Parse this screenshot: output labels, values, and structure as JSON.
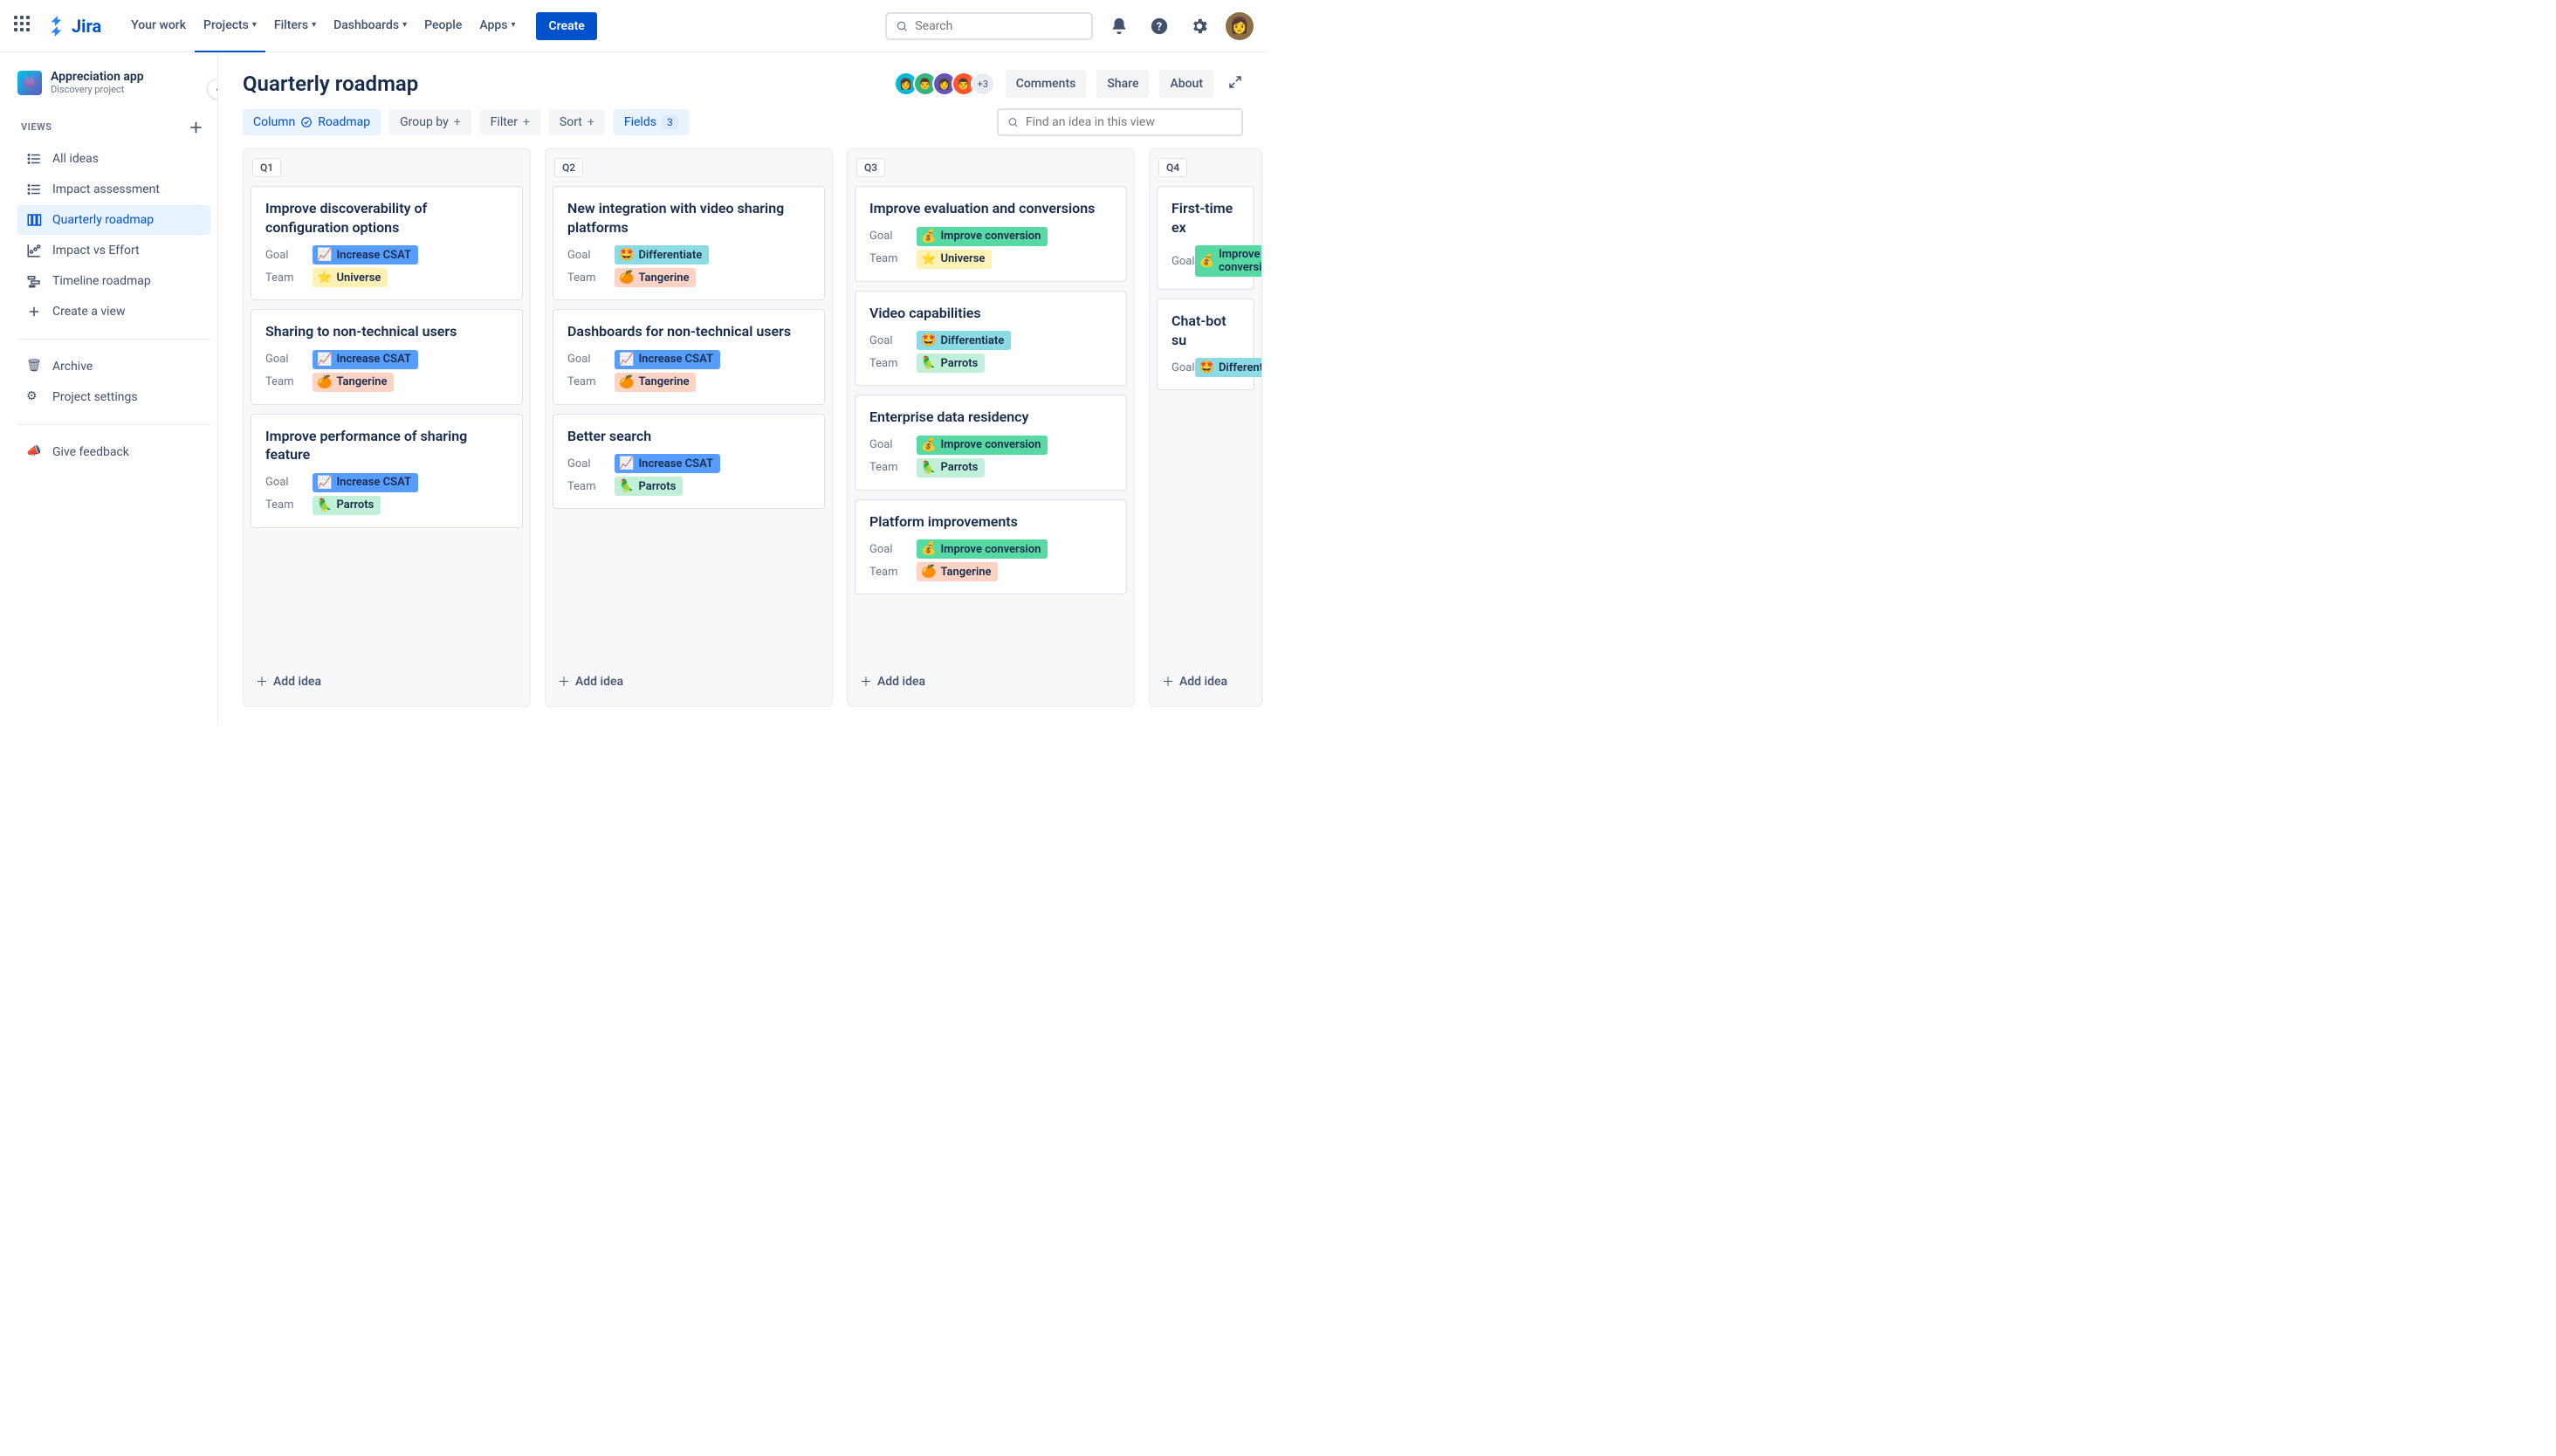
{
  "nav": {
    "logo": "Jira",
    "items": [
      "Your work",
      "Projects",
      "Filters",
      "Dashboards",
      "People",
      "Apps"
    ],
    "create": "Create",
    "search_placeholder": "Search"
  },
  "project": {
    "name": "Appreciation app",
    "type": "Discovery project"
  },
  "sidebar": {
    "views_header": "VIEWS",
    "items": [
      {
        "label": "All ideas",
        "icon": "list"
      },
      {
        "label": "Impact assessment",
        "icon": "list"
      },
      {
        "label": "Quarterly roadmap",
        "icon": "board",
        "active": true
      },
      {
        "label": "Impact vs Effort",
        "icon": "chart"
      },
      {
        "label": "Timeline roadmap",
        "icon": "timeline"
      },
      {
        "label": "Create a view",
        "icon": "plus"
      }
    ],
    "archive": "Archive",
    "settings": "Project settings",
    "feedback": "Give feedback"
  },
  "page": {
    "title": "Quarterly roadmap",
    "avatar_more": "+3",
    "actions": {
      "comments": "Comments",
      "share": "Share",
      "about": "About"
    },
    "controls": {
      "column": "Column",
      "column_value": "Roadmap",
      "group": "Group by",
      "filter": "Filter",
      "sort": "Sort",
      "fields": "Fields",
      "fields_count": "3"
    },
    "find_placeholder": "Find an idea in this view",
    "add_idea": "Add idea"
  },
  "labels": {
    "goal": "Goal",
    "team": "Team"
  },
  "goals": {
    "csat": {
      "text": "Increase CSAT",
      "emoji": "📈",
      "bg": "#579DFF",
      "fg": "#0747A6",
      "bg2": "#4C9AFF"
    },
    "diff": {
      "text": "Differentiate",
      "emoji": "🤩",
      "bg": "#79E2F2"
    },
    "conv": {
      "text": "Improve conversion",
      "emoji": "💰",
      "bg": "#57D9A3"
    }
  },
  "teams": {
    "universe": {
      "text": "Universe",
      "emoji": "⭐",
      "bg": "#FFF0B3"
    },
    "tangerine": {
      "text": "Tangerine",
      "emoji": "🍊",
      "bg": "#FFD3C4"
    },
    "parrots": {
      "text": "Parrots",
      "emoji": "🦜",
      "bg": "#C1F0D8"
    }
  },
  "columns": [
    {
      "name": "Q1",
      "cards": [
        {
          "title": "Improve discoverability of configuration options",
          "goal": "csat",
          "team": "universe"
        },
        {
          "title": "Sharing to non-technical users",
          "goal": "csat",
          "team": "tangerine"
        },
        {
          "title": "Improve performance of sharing feature",
          "goal": "csat",
          "team": "parrots"
        }
      ]
    },
    {
      "name": "Q2",
      "cards": [
        {
          "title": "New integration with video sharing platforms",
          "goal": "diff",
          "team": "tangerine"
        },
        {
          "title": "Dashboards for non-technical users",
          "goal": "csat",
          "team": "tangerine"
        },
        {
          "title": "Better search",
          "goal": "csat",
          "team": "parrots"
        }
      ]
    },
    {
      "name": "Q3",
      "cards": [
        {
          "title": "Improve evaluation and conversions",
          "goal": "conv",
          "team": "universe"
        },
        {
          "title": "Video capabilities",
          "goal": "diff",
          "team": "parrots"
        },
        {
          "title": "Enterprise data residency",
          "goal": "conv",
          "team": "parrots"
        },
        {
          "title": "Platform improvements",
          "goal": "conv",
          "team": "tangerine"
        }
      ]
    },
    {
      "name": "Q4",
      "cards": [
        {
          "title": "First-time ex",
          "goal": "conv"
        },
        {
          "title": "Chat-bot su",
          "goal": "diff"
        }
      ],
      "truncated": true
    }
  ]
}
